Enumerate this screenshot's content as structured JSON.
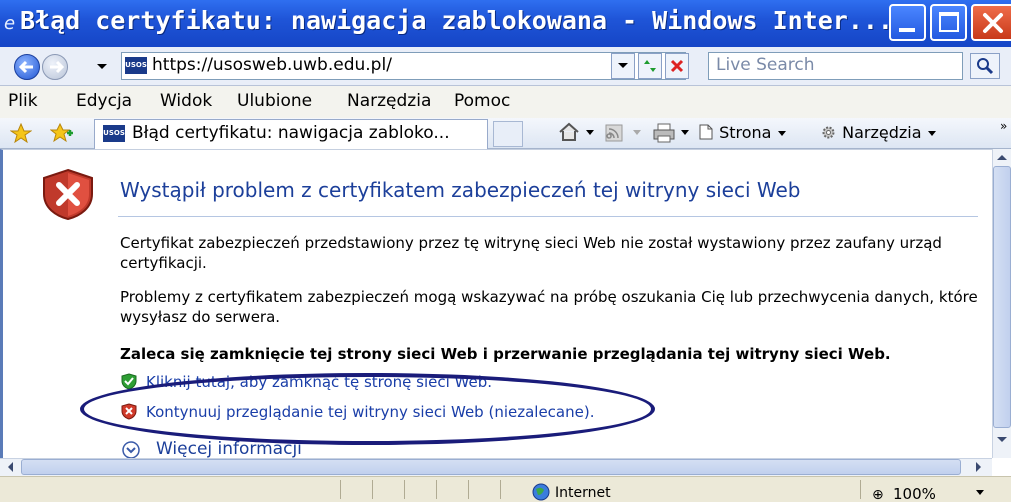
{
  "window": {
    "title": "Błąd certyfikatu: nawigacja zablokowana - Windows Inter..."
  },
  "address_bar": {
    "url": "https://usosweb.uwb.edu.pl/",
    "search_placeholder": "Live Search"
  },
  "menu": [
    "Plik",
    "Edycja",
    "Widok",
    "Ulubione",
    "Narzędzia",
    "Pomoc"
  ],
  "tab": {
    "title": "Błąd certyfikatu: nawigacja zabloko..."
  },
  "toolbar": {
    "page_label": "Strona",
    "tools_label": "Narzędzia"
  },
  "page": {
    "heading": "Wystąpił problem z certyfikatem zabezpieczeń tej witryny sieci Web",
    "para1": "Certyfikat zabezpieczeń przedstawiony przez tę witrynę sieci Web nie został wystawiony przez zaufany urząd certyfikacji.",
    "para2": "Problemy z certyfikatem zabezpieczeń mogą wskazywać na próbę oszukania Cię lub przechwycenia danych, które wysyłasz do serwera.",
    "recommendation": "Zaleca się zamknięcie tej strony sieci Web i przerwanie przeglądania tej witryny sieci Web.",
    "link_close": "Kliknij tutaj, aby zamknąć tę stronę sieci Web.",
    "link_continue": "Kontynuuj przeglądanie tej witryny sieci Web (niezalecane).",
    "more_info": "Więcej informacji"
  },
  "status_bar": {
    "zone": "Internet",
    "zoom": "100%"
  },
  "colors": {
    "titlebar": "#1f55d8",
    "heading": "#1c3f9a",
    "link": "#1a3ea8",
    "annotation_ellipse": "#1a1c7a"
  },
  "icons": [
    "ie-logo-icon",
    "back-arrow-icon",
    "forward-arrow-icon",
    "site-favicon-icon",
    "refresh-icon",
    "stop-icon",
    "search-icon",
    "favorites-star-icon",
    "add-favorites-icon",
    "home-icon",
    "feeds-icon",
    "print-icon",
    "page-icon",
    "gear-icon",
    "shield-error-icon",
    "shield-ok-icon",
    "shield-x-icon",
    "chevron-down-icon",
    "globe-icon",
    "zoom-icon"
  ]
}
